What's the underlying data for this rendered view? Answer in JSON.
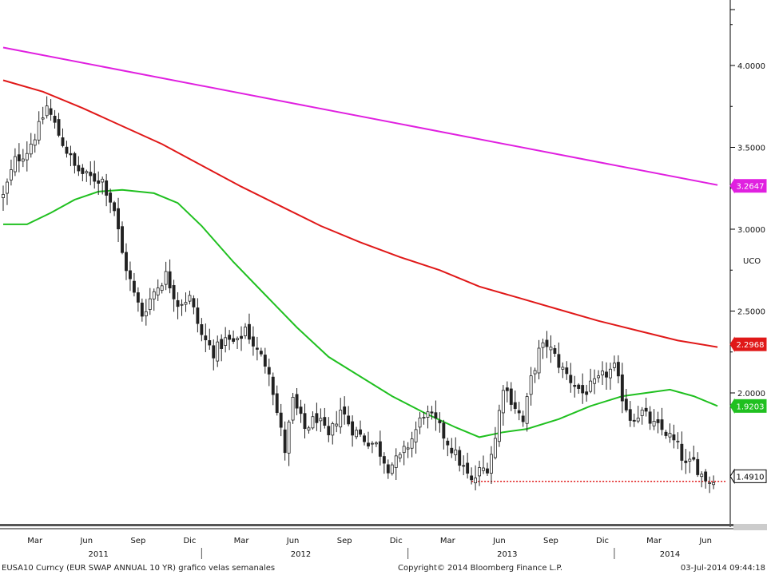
{
  "chart_data": {
    "type": "candlestick",
    "title": "",
    "ylim": [
      1.2,
      4.4
    ],
    "y_ticks": [
      "4.0000",
      "3.5000",
      "3.0000",
      "2.5000",
      "2.0000"
    ],
    "y_tick_values": [
      4.0,
      3.5,
      3.0,
      2.5,
      2.0
    ],
    "x_range_weeks": [
      0,
      182
    ],
    "month_ticks": [
      {
        "label": "Mar",
        "week": 8
      },
      {
        "label": "Jun",
        "week": 21
      },
      {
        "label": "Sep",
        "week": 34
      },
      {
        "label": "Dic",
        "week": 47
      },
      {
        "label": "Mar",
        "week": 60
      },
      {
        "label": "Jun",
        "week": 73
      },
      {
        "label": "Sep",
        "week": 86
      },
      {
        "label": "Dic",
        "week": 99
      },
      {
        "label": "Mar",
        "week": 112
      },
      {
        "label": "Jun",
        "week": 125
      },
      {
        "label": "Sep",
        "week": 138
      },
      {
        "label": "Dic",
        "week": 151
      },
      {
        "label": "Mar",
        "week": 164
      },
      {
        "label": "Jun",
        "week": 177
      }
    ],
    "year_labels": [
      {
        "label": "2011",
        "week": 24
      },
      {
        "label": "2012",
        "week": 75
      },
      {
        "label": "2013",
        "week": 127
      },
      {
        "label": "2014",
        "week": 168
      }
    ],
    "year_separators": [
      50,
      102,
      154
    ],
    "close_anchors": [
      [
        0,
        3.2
      ],
      [
        3,
        3.42
      ],
      [
        6,
        3.48
      ],
      [
        9,
        3.62
      ],
      [
        11,
        3.75
      ],
      [
        14,
        3.58
      ],
      [
        18,
        3.38
      ],
      [
        21,
        3.32
      ],
      [
        25,
        3.3
      ],
      [
        28,
        3.12
      ],
      [
        30,
        2.85
      ],
      [
        33,
        2.6
      ],
      [
        35,
        2.48
      ],
      [
        38,
        2.62
      ],
      [
        41,
        2.72
      ],
      [
        44,
        2.55
      ],
      [
        47,
        2.58
      ],
      [
        50,
        2.35
      ],
      [
        53,
        2.25
      ],
      [
        56,
        2.32
      ],
      [
        59,
        2.3
      ],
      [
        61,
        2.4
      ],
      [
        64,
        2.25
      ],
      [
        67,
        2.15
      ],
      [
        69,
        1.88
      ],
      [
        71,
        1.65
      ],
      [
        73,
        1.95
      ],
      [
        76,
        1.78
      ],
      [
        79,
        1.85
      ],
      [
        82,
        1.72
      ],
      [
        85,
        1.9
      ],
      [
        88,
        1.78
      ],
      [
        91,
        1.72
      ],
      [
        94,
        1.68
      ],
      [
        97,
        1.55
      ],
      [
        100,
        1.6
      ],
      [
        103,
        1.72
      ],
      [
        106,
        1.88
      ],
      [
        109,
        1.82
      ],
      [
        112,
        1.7
      ],
      [
        115,
        1.58
      ],
      [
        118,
        1.45
      ],
      [
        120,
        1.52
      ],
      [
        122,
        1.55
      ],
      [
        124,
        1.72
      ],
      [
        126,
        2.05
      ],
      [
        129,
        1.92
      ],
      [
        131,
        1.82
      ],
      [
        133,
        2.08
      ],
      [
        135,
        2.25
      ],
      [
        137,
        2.3
      ],
      [
        139,
        2.22
      ],
      [
        141,
        2.14
      ],
      [
        143,
        2.08
      ],
      [
        146,
        2.0
      ],
      [
        149,
        2.05
      ],
      [
        152,
        2.12
      ],
      [
        154,
        2.15
      ],
      [
        156,
        1.98
      ],
      [
        158,
        1.85
      ],
      [
        161,
        1.88
      ],
      [
        164,
        1.8
      ],
      [
        167,
        1.76
      ],
      [
        170,
        1.67
      ],
      [
        172,
        1.55
      ],
      [
        174,
        1.58
      ],
      [
        176,
        1.5
      ],
      [
        178,
        1.46
      ],
      [
        179,
        1.49
      ]
    ],
    "series": [
      {
        "name": "",
        "color": "#e020e0",
        "values": [
          [
            0,
            4.11
          ],
          [
            180,
            3.27
          ]
        ]
      },
      {
        "name": "",
        "color": "#e01818",
        "values": [
          [
            0,
            3.91
          ],
          [
            10,
            3.84
          ],
          [
            20,
            3.74
          ],
          [
            30,
            3.63
          ],
          [
            40,
            3.52
          ],
          [
            50,
            3.39
          ],
          [
            60,
            3.26
          ],
          [
            70,
            3.14
          ],
          [
            80,
            3.02
          ],
          [
            90,
            2.92
          ],
          [
            100,
            2.83
          ],
          [
            110,
            2.75
          ],
          [
            120,
            2.65
          ],
          [
            130,
            2.58
          ],
          [
            140,
            2.51
          ],
          [
            150,
            2.44
          ],
          [
            160,
            2.38
          ],
          [
            170,
            2.32
          ],
          [
            180,
            2.28
          ]
        ]
      },
      {
        "name": "",
        "color": "#20c020",
        "values": [
          [
            0,
            3.03
          ],
          [
            6,
            3.03
          ],
          [
            12,
            3.1
          ],
          [
            18,
            3.18
          ],
          [
            24,
            3.23
          ],
          [
            30,
            3.24
          ],
          [
            38,
            3.22
          ],
          [
            44,
            3.16
          ],
          [
            50,
            3.02
          ],
          [
            58,
            2.8
          ],
          [
            66,
            2.6
          ],
          [
            74,
            2.4
          ],
          [
            82,
            2.22
          ],
          [
            90,
            2.1
          ],
          [
            98,
            1.98
          ],
          [
            106,
            1.88
          ],
          [
            114,
            1.79
          ],
          [
            120,
            1.73
          ],
          [
            126,
            1.76
          ],
          [
            132,
            1.78
          ],
          [
            140,
            1.84
          ],
          [
            148,
            1.92
          ],
          [
            156,
            1.98
          ],
          [
            162,
            2.0
          ],
          [
            168,
            2.02
          ],
          [
            174,
            1.98
          ],
          [
            180,
            1.92
          ]
        ]
      }
    ],
    "value_badges": [
      {
        "text": "3.2647",
        "bg": "#e020e0",
        "fg": "#ffffff",
        "value": 3.2647
      },
      {
        "text": "2.2968",
        "bg": "#e01818",
        "fg": "#ffffff",
        "value": 2.2968
      },
      {
        "text": "1.9203",
        "bg": "#20c020",
        "fg": "#ffffff",
        "value": 1.9203
      },
      {
        "text": "1.4910",
        "bg": "#ffffff",
        "fg": "#000000",
        "value": 1.491
      }
    ],
    "support_level": {
      "value": 1.46,
      "from_week": 118,
      "to_week": 182,
      "color": "#e01818"
    },
    "partial_right_label": "UCO",
    "candle_colors": {
      "up": "#ffffff",
      "down": "#222222",
      "wick": "#222222"
    }
  },
  "footer": {
    "left_text": "EUSA10 Curncy (EUR SWAP ANNUAL    10 YR) grafico velas semanales",
    "copyright": "Copyright© 2014 Bloomberg Finance L.P.",
    "timestamp": "03-Jul-2014 09:44:18"
  }
}
